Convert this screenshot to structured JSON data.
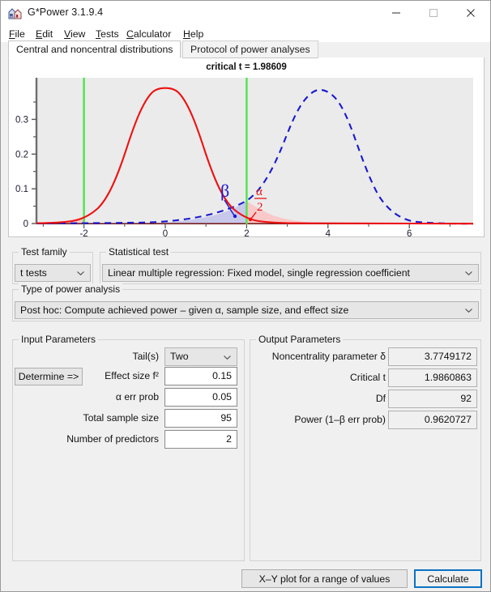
{
  "window": {
    "title": "G*Power 3.1.9.4",
    "icon": "gpower-app-icon",
    "minimize": "minimize-icon",
    "maximize": "maximize-icon",
    "close": "close-icon"
  },
  "menu": {
    "items": [
      {
        "label": "File",
        "mnemonic": "F"
      },
      {
        "label": "Edit",
        "mnemonic": "E"
      },
      {
        "label": "View",
        "mnemonic": "V"
      },
      {
        "label": "Tests",
        "mnemonic": "T"
      },
      {
        "label": "Calculator",
        "mnemonic": "C"
      },
      {
        "label": "Help",
        "mnemonic": "H"
      }
    ]
  },
  "tabs": [
    {
      "label": "Central and noncentral distributions",
      "active": true
    },
    {
      "label": "Protocol of power analyses",
      "active": false
    }
  ],
  "chart_data": {
    "type": "line",
    "title": "critical t = 1.98609",
    "xlabel": "",
    "ylabel": "",
    "xlim": [
      -3.2,
      7.6
    ],
    "ylim": [
      0,
      0.42
    ],
    "grid": false,
    "legend": false,
    "xticks": [
      -2,
      0,
      2,
      4,
      6
    ],
    "xtick_labels": [
      "-2",
      "0",
      "2",
      "4",
      "6"
    ],
    "xticks_minor": [
      -3,
      -1,
      1,
      3,
      5,
      7
    ],
    "yticks": [
      0,
      0.1,
      0.2,
      0.3
    ],
    "ytick_labels": [
      "0",
      "0.1",
      "0.2",
      "0.3"
    ],
    "yticks_minor": [
      0.05,
      0.15,
      0.25,
      0.35
    ],
    "critical_value": 1.98609,
    "critical_line_color": "#4ee44e",
    "critical_lines": [
      -1.98609,
      1.98609
    ],
    "series": [
      {
        "name": "central t distribution (H0)",
        "style": "solid",
        "color": "#ee1111",
        "distribution": "t",
        "df": 92,
        "ncp": 0,
        "peak_x": 0,
        "peak_y": 0.3959
      },
      {
        "name": "noncentral t distribution (H1)",
        "style": "dashed",
        "color": "#1a1ad0",
        "distribution": "noncentral-t",
        "df": 92,
        "ncp": 3.7749172,
        "peak_x": 3.72,
        "peak_y": 0.3815
      }
    ],
    "annotations": [
      {
        "label": "β",
        "color": "#1a1ad0",
        "x": 1.05,
        "y": 0.098,
        "point_x": 1.62,
        "point_y": 0.022
      },
      {
        "label": "α/2",
        "color": "#ee1111",
        "x": 2.42,
        "y": 0.105,
        "point_x": 2.22,
        "point_y": 0.02
      }
    ],
    "shaded_regions": [
      {
        "name": "alpha/2 lower tail",
        "color": "#f9c8c8",
        "from": -3.2,
        "to": -1.98609,
        "series": "central t distribution (H0)"
      },
      {
        "name": "beta region",
        "color": "#c4c4ea",
        "from": -3.2,
        "to": 1.98609,
        "series": "noncentral t distribution (H1)"
      },
      {
        "name": "alpha/2 upper tail",
        "color": "#f9c8c8",
        "from": 1.98609,
        "to": 7.6,
        "series": "central t distribution (H0)"
      }
    ],
    "plot_bg": "#ebebeb",
    "panel_bg": "#ffffff"
  },
  "test_family": {
    "legend": "Test family",
    "value": "t tests"
  },
  "statistical_test": {
    "legend": "Statistical test",
    "value": "Linear multiple regression: Fixed model, single regression coefficient"
  },
  "power_analysis": {
    "legend": "Type of power analysis",
    "value": "Post hoc: Compute achieved power – given α, sample size, and effect size"
  },
  "input_parameters": {
    "legend": "Input Parameters",
    "determine_button": "Determine =>",
    "rows": [
      {
        "label": "Tail(s)",
        "value": "Two",
        "type": "combo"
      },
      {
        "label": "Effect size f²",
        "value": "0.15",
        "type": "field"
      },
      {
        "label": "α err prob",
        "value": "0.05",
        "type": "field"
      },
      {
        "label": "Total sample size",
        "value": "95",
        "type": "field"
      },
      {
        "label": "Number of predictors",
        "value": "2",
        "type": "field"
      }
    ]
  },
  "output_parameters": {
    "legend": "Output Parameters",
    "rows": [
      {
        "label": "Noncentrality parameter δ",
        "value": "3.7749172"
      },
      {
        "label": "Critical t",
        "value": "1.9860863"
      },
      {
        "label": "Df",
        "value": "92"
      },
      {
        "label": "Power (1–β err prob)",
        "value": "0.9620727"
      }
    ]
  },
  "footer": {
    "xy_plot_button": "X–Y plot for a range of values",
    "calculate_button": "Calculate"
  },
  "colors": {
    "accent": "#0b72c4",
    "h0_curve": "#ee1111",
    "h1_curve": "#1a1ad0",
    "critical_line": "#4ee44e"
  }
}
